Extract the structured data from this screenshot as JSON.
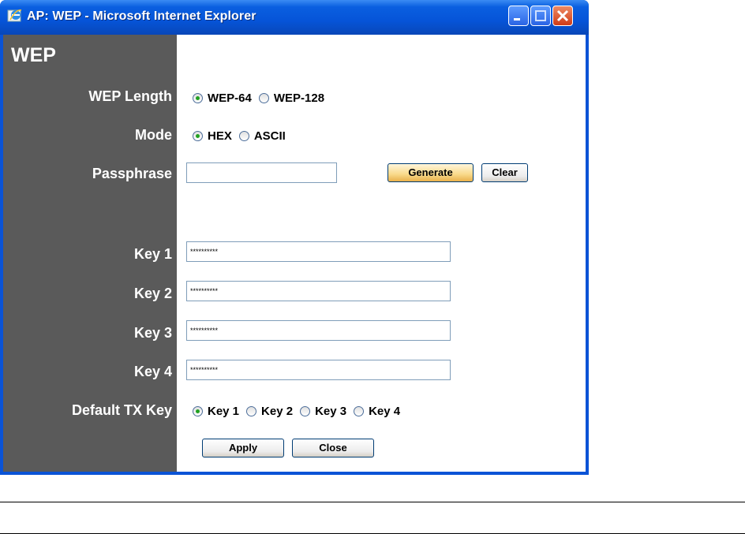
{
  "window": {
    "title": "AP: WEP - Microsoft Internet Explorer"
  },
  "page": {
    "heading": "WEP"
  },
  "wep_length": {
    "label": "WEP Length",
    "options": [
      "WEP-64",
      "WEP-128"
    ],
    "selected": "WEP-64"
  },
  "mode": {
    "label": "Mode",
    "options": [
      "HEX",
      "ASCII"
    ],
    "selected": "HEX"
  },
  "passphrase": {
    "label": "Passphrase",
    "value": "",
    "generate_label": "Generate",
    "clear_label": "Clear"
  },
  "keys": [
    {
      "label": "Key 1",
      "value": "**********"
    },
    {
      "label": "Key 2",
      "value": "**********"
    },
    {
      "label": "Key 3",
      "value": "**********"
    },
    {
      "label": "Key 4",
      "value": "**********"
    }
  ],
  "default_tx_key": {
    "label": "Default TX Key",
    "options": [
      "Key 1",
      "Key 2",
      "Key 3",
      "Key 4"
    ],
    "selected": "Key 1"
  },
  "actions": {
    "apply_label": "Apply",
    "close_label": "Close"
  },
  "colors": {
    "sidebar": "#5a5a5a",
    "titlebar": "#0654d8",
    "radio_dot": "#21a121"
  }
}
